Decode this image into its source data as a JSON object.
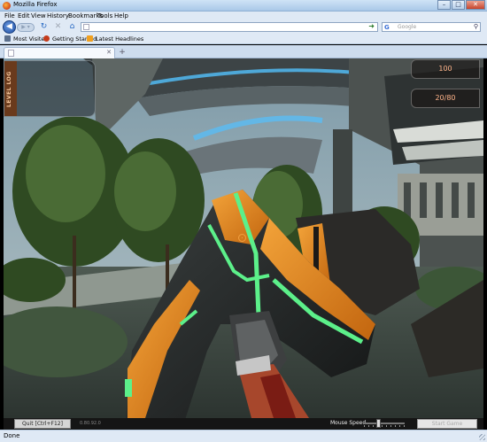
{
  "window": {
    "title": "Mozilla Firefox",
    "buttons": {
      "minimize": "–",
      "maximize": "□",
      "close": "✕"
    }
  },
  "menu": [
    "File",
    "Edit",
    "View",
    "History",
    "Bookmarks",
    "Tools",
    "Help"
  ],
  "nav": {
    "url": "",
    "search_placeholder": "Google",
    "search_engine_glyph": "G"
  },
  "bookmarks": [
    "Most Visited",
    "Getting Started",
    "Latest Headlines"
  ],
  "tab": {
    "title": ""
  },
  "game": {
    "level_log_label": "LEVEL LOG",
    "hud_top": "100",
    "hud_bottom": "20/80",
    "quit_label": "Quit [Ctrl+F12]",
    "version": "0.80.92.0",
    "mouse_speed_label": "Mouse Speed",
    "mouse_speed_level": 0.35,
    "start_label": "Start Game"
  },
  "status": {
    "text": "Done"
  },
  "colors": {
    "accent_glow": "#5cf08a",
    "weapon_orange": "#e8891c",
    "hud_text": "#ffb48a"
  }
}
